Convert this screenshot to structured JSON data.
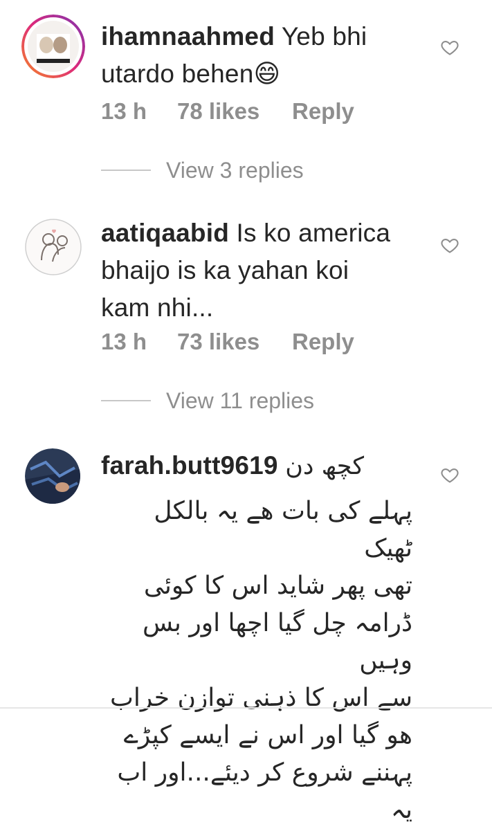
{
  "comments": [
    {
      "username": "ihamnaahmed",
      "text": "Yeb bhi",
      "text2": "utardo behen",
      "emoji": "😄",
      "time": "13 h",
      "likes": "78 likes",
      "reply": "Reply",
      "view_replies": "View 3 replies"
    },
    {
      "username": "aatiqaabid",
      "text": "Is ko america",
      "text2": "bhaijo is ka yahan koi",
      "text3": "kam nhi...",
      "time": "13 h",
      "likes": "73 likes",
      "reply": "Reply",
      "view_replies": "View 11 replies"
    },
    {
      "username": "farah.butt9619",
      "first_inline": "کچھ دن",
      "lines": [
        "پہلے کی بات ھے یہ بالکل ٹھیک",
        "تھی پھر شاید اس کا کوئی",
        "ڈرامہ چل گیا اچھا اور بس وہیں",
        "سے اس کا ذہنی توازن خراب",
        "ھو گیا اور اس نے ایسے کپڑے",
        "پہننے شروع کر دیئے...اور اب یہ"
      ]
    }
  ],
  "icons": {
    "heart": "heart-outline-icon",
    "avatar_ring_colors": [
      "#f58529",
      "#dd2a7b",
      "#8134af"
    ]
  }
}
